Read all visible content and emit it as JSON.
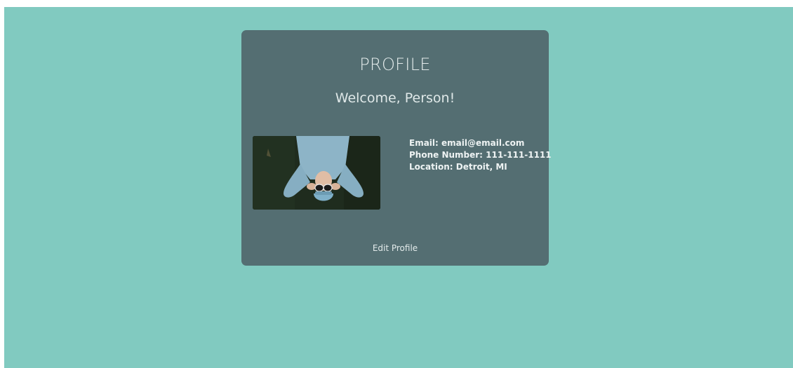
{
  "profile": {
    "title": "PROFILE",
    "welcome": "Welcome, Person!",
    "email_label": "Email:",
    "email": "email@email.com",
    "phone_label": "Phone Number:",
    "phone": "111-111-1111",
    "location_label": "Location:",
    "location": "Detroit, MI",
    "edit_button": "Edit Profile"
  },
  "colors": {
    "background": "#81cac0",
    "card": "#546e72",
    "text": "#e6eeee"
  }
}
